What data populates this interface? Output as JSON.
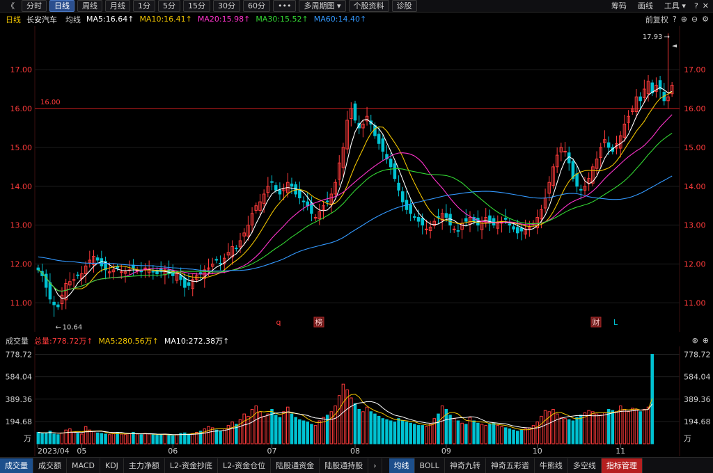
{
  "toolbar": {
    "collapse": "《",
    "periods": [
      "分时",
      "日线",
      "周线",
      "月线",
      "1分",
      "5分",
      "15分",
      "30分",
      "60分",
      "•••",
      "多周期图 ▾",
      "个股资料",
      "诊股"
    ],
    "active": 1,
    "right": [
      "筹码",
      "画线",
      "工具 ▾"
    ]
  },
  "info": {
    "period": "日线",
    "name": "长安汽车",
    "ma_label": "均线",
    "mas": [
      {
        "text": "MA5:16.64↑",
        "color": "#ffffff"
      },
      {
        "text": "MA10:16.41↑",
        "color": "#f0c400"
      },
      {
        "text": "MA20:15.98↑",
        "color": "#ff33cc"
      },
      {
        "text": "MA30:15.52↑",
        "color": "#33d633"
      },
      {
        "text": "MA60:14.40↑",
        "color": "#3399ff"
      }
    ],
    "adjust": "前复权"
  },
  "volume_info": {
    "title": "成交量",
    "items": [
      {
        "text": "总量:778.72万↑",
        "color": "#ff3b3b"
      },
      {
        "text": "MA5:280.56万↑",
        "color": "#f0c400"
      },
      {
        "text": "MA10:272.38万↑",
        "color": "#ffffff"
      }
    ]
  },
  "chart_data": {
    "type": "candlestick",
    "price_axis": {
      "ticks": [
        "17.00",
        "16.00",
        "15.00",
        "14.00",
        "13.00",
        "12.00",
        "11.00"
      ],
      "min": 10.4,
      "max": 17.95
    },
    "volume_axis": {
      "ticks": [
        "778.72",
        "584.04",
        "389.36",
        "194.68"
      ],
      "unit": "万",
      "max": 800
    },
    "x_labels": [
      "2023/04",
      "05",
      "06",
      "07",
      "08",
      "09",
      "10",
      "11"
    ],
    "x_label_index": [
      0,
      11,
      34,
      59,
      80,
      103,
      126,
      147
    ],
    "reference_line": {
      "label": "16.00",
      "value": 16.0
    },
    "annotations": {
      "high": "17.93",
      "low": "10.64"
    },
    "markers": [
      "q",
      "榜",
      "财",
      "L"
    ],
    "closes": [
      11.85,
      11.7,
      11.4,
      11.1,
      10.95,
      10.9,
      11.2,
      11.5,
      11.55,
      11.6,
      11.7,
      11.75,
      11.95,
      12.1,
      12.2,
      12.1,
      11.95,
      11.85,
      11.8,
      11.85,
      11.9,
      11.8,
      11.8,
      11.85,
      11.9,
      11.85,
      11.8,
      11.9,
      11.85,
      11.8,
      11.75,
      11.8,
      11.85,
      11.75,
      11.7,
      11.75,
      11.6,
      11.4,
      11.45,
      11.6,
      11.7,
      11.75,
      11.85,
      11.9,
      12.0,
      12.1,
      12.0,
      12.15,
      12.3,
      12.45,
      12.4,
      12.6,
      12.8,
      13.0,
      13.3,
      13.5,
      13.6,
      13.8,
      14.0,
      14.1,
      13.9,
      13.8,
      13.95,
      14.1,
      14.0,
      13.8,
      13.7,
      13.6,
      13.5,
      13.3,
      13.2,
      13.35,
      13.5,
      13.6,
      13.8,
      14.1,
      14.6,
      15.0,
      15.7,
      16.0,
      15.7,
      15.5,
      15.6,
      15.8,
      15.6,
      15.3,
      15.1,
      14.9,
      14.7,
      14.5,
      14.2,
      13.9,
      13.6,
      13.4,
      13.3,
      13.2,
      13.1,
      13.0,
      12.9,
      12.95,
      13.1,
      13.2,
      13.3,
      13.2,
      13.0,
      12.9,
      12.85,
      13.05,
      13.1,
      13.2,
      13.1,
      13.0,
      13.1,
      13.2,
      13.05,
      13.0,
      13.05,
      13.1,
      13.15,
      13.0,
      12.9,
      12.8,
      12.85,
      12.9,
      12.95,
      13.05,
      13.2,
      13.4,
      13.7,
      14.1,
      14.5,
      14.8,
      15.0,
      14.9,
      14.6,
      14.2,
      14.0,
      13.9,
      14.0,
      14.2,
      14.5,
      14.7,
      15.0,
      15.2,
      15.0,
      14.9,
      15.1,
      15.3,
      15.6,
      15.8,
      16.0,
      16.3,
      16.2,
      16.5,
      16.7,
      16.4,
      16.6,
      16.5,
      16.2,
      16.3,
      16.6
    ],
    "volumes": [
      100,
      90,
      95,
      110,
      85,
      80,
      95,
      120,
      130,
      100,
      90,
      85,
      150,
      120,
      110,
      95,
      90,
      85,
      80,
      90,
      95,
      85,
      80,
      90,
      100,
      85,
      80,
      90,
      85,
      80,
      75,
      80,
      85,
      75,
      70,
      80,
      90,
      95,
      85,
      90,
      100,
      110,
      130,
      150,
      140,
      120,
      110,
      130,
      160,
      190,
      170,
      210,
      260,
      240,
      300,
      330,
      280,
      240,
      260,
      300,
      250,
      230,
      280,
      320,
      260,
      230,
      210,
      200,
      190,
      170,
      160,
      200,
      230,
      250,
      280,
      330,
      420,
      520,
      470,
      400,
      350,
      300,
      280,
      320,
      280,
      260,
      240,
      220,
      210,
      200,
      190,
      220,
      200,
      190,
      180,
      170,
      160,
      160,
      150,
      170,
      220,
      260,
      330,
      300,
      250,
      220,
      200,
      180,
      170,
      230,
      200,
      180,
      170,
      160,
      170,
      180,
      160,
      150,
      140,
      130,
      120,
      110,
      120,
      130,
      140,
      160,
      190,
      240,
      290,
      280,
      300,
      260,
      230,
      220,
      210,
      200,
      230,
      250,
      270,
      290,
      280,
      260,
      250,
      270,
      300,
      290,
      280,
      330,
      300,
      280,
      310,
      300,
      280,
      300,
      320,
      778.72
    ]
  },
  "bottom_tabs": {
    "left": [
      "成交量",
      "成交额",
      "MACD",
      "KDJ",
      "主力净额",
      "L2-资金抄底",
      "L2-资金仓位",
      "陆股通资金",
      "陆股通持股"
    ],
    "arrow": "›",
    "right": [
      "均线",
      "BOLL",
      "神奇九转",
      "神奇五彩谱",
      "牛熊线",
      "多空线",
      "指标管理"
    ]
  },
  "colors": {
    "up": "#ff3b3b",
    "down": "#00c2d2",
    "ma5": "#ffffff",
    "ma10": "#f0c400",
    "ma20": "#ff33cc",
    "ma30": "#33d633",
    "ma60": "#3399ff"
  }
}
